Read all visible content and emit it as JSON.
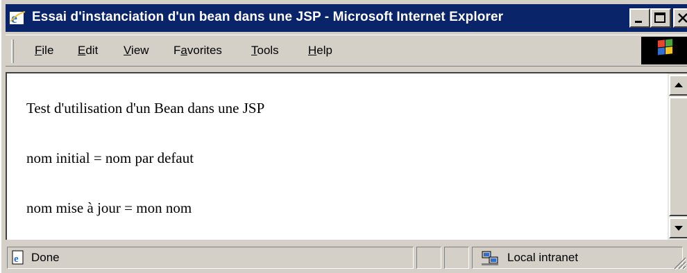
{
  "window": {
    "title": "Essai d'instanciation d'un bean dans une JSP - Microsoft Internet Explorer",
    "title_bar_color": "#0a246a",
    "icons": {
      "app": "ie-logo-icon",
      "minimize": "minimize-icon",
      "maximize": "maximize-icon",
      "close": "close-icon"
    }
  },
  "menu": {
    "items": [
      {
        "label": "File",
        "accel": "F",
        "rest": "ile"
      },
      {
        "label": "Edit",
        "accel": "E",
        "rest": "dit"
      },
      {
        "label": "View",
        "accel": "V",
        "rest": "iew"
      },
      {
        "label": "Favorites",
        "pre": "F",
        "accel": "a",
        "rest": "vorites"
      },
      {
        "label": "Tools",
        "accel": "T",
        "rest": "ools"
      },
      {
        "label": "Help",
        "accel": "H",
        "rest": "elp"
      }
    ],
    "logo_icon": "windows-flag-icon"
  },
  "page": {
    "lines": [
      "Test d'utilisation d'un Bean dans une JSP",
      "nom initial = nom par defaut",
      "nom mise à jour = mon nom"
    ]
  },
  "status": {
    "text": "Done",
    "icon": "ie-page-icon",
    "zone": "Local intranet",
    "zone_icon": "local-intranet-icon"
  }
}
